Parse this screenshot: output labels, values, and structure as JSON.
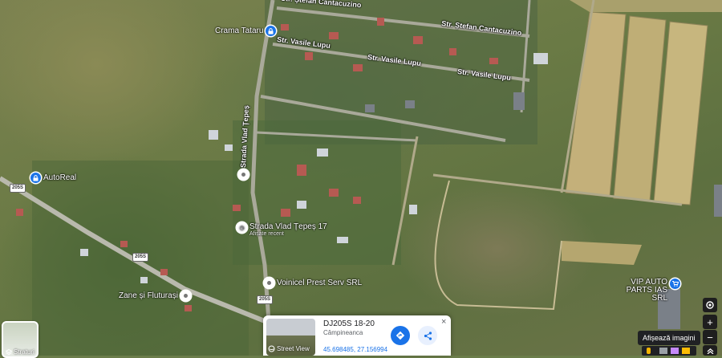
{
  "map": {
    "type": "satellite",
    "pois": [
      {
        "name": "Crama Tataru",
        "icon": "lock-icon"
      },
      {
        "name": "AutoReal",
        "icon": "lock-icon"
      },
      {
        "name": "Strada Vlad Țepeș 17",
        "subtitle": "Afișate recent",
        "icon": "history-pin-icon"
      },
      {
        "name": "Voinicel Prest Serv SRL",
        "icon": "place-pin-icon"
      },
      {
        "name": "Zane și Fluturași",
        "icon": "place-pin-icon"
      },
      {
        "name": "VIP AUTO PARTS IAS SRL",
        "icon": "shopping-cart-icon"
      }
    ],
    "streets": [
      {
        "name": "Strada Vlad Țepeș"
      },
      {
        "name": "Str. Vasile Lupu"
      },
      {
        "name": "Str. Vasile Lupu"
      },
      {
        "name": "Str. Vasile Lupu"
      },
      {
        "name": "Str. Ștefan Cantacuzino"
      },
      {
        "name": "Str. Ștefan Cantacuzino"
      }
    ],
    "road_shields": [
      "205S",
      "205S",
      "205S"
    ]
  },
  "controls": {
    "layers_label": "Straturi",
    "zoom_in": "+",
    "zoom_out": "−",
    "tooltip": "Afișează imagini"
  },
  "card": {
    "street_view_label": "Street View",
    "address": "DJ205S 18-20",
    "locality": "Câmpineanca",
    "coordinates": "45.698485, 27.156994",
    "close": "×"
  }
}
